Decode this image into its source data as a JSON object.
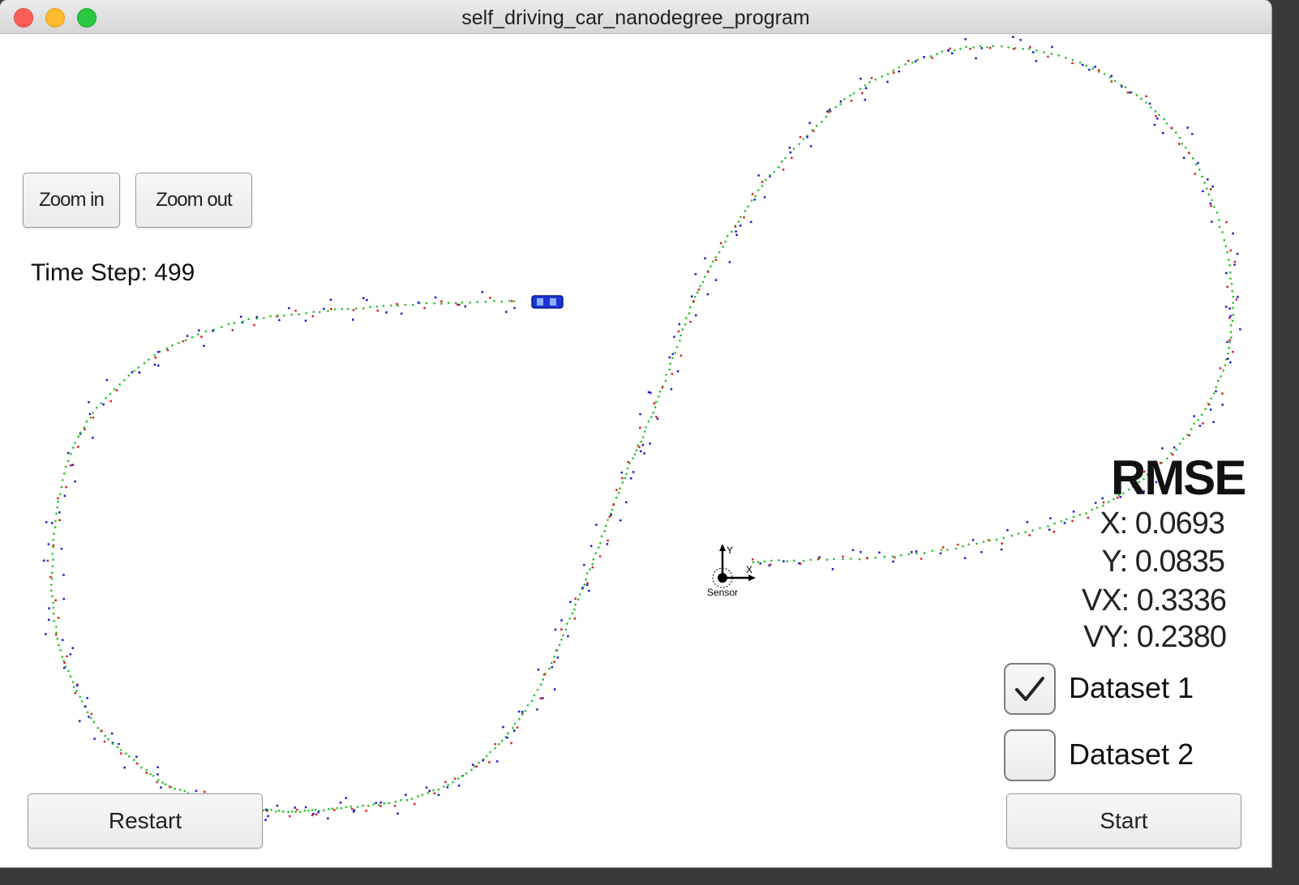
{
  "window": {
    "title": "self_driving_car_nanodegree_program"
  },
  "controls": {
    "zoom_in": "Zoom in",
    "zoom_out": "Zoom out",
    "restart": "Restart",
    "start": "Start"
  },
  "status": {
    "time_step_label": "Time Step: 499"
  },
  "rmse": {
    "title": "RMSE",
    "x": "X: 0.0693",
    "y": "Y: 0.0835",
    "vx": "VX: 0.3336",
    "vy": "VY: 0.2380"
  },
  "datasets": [
    {
      "label": "Dataset 1",
      "checked": true
    },
    {
      "label": "Dataset 2",
      "checked": false
    }
  ],
  "sensor": {
    "label": "Sensor",
    "x_axis": "X",
    "y_axis": "Y"
  },
  "colors": {
    "ground_truth": "#22c122",
    "lidar": "#e11b1b",
    "radar": "#1a1ad0",
    "car": "#1b34d8"
  }
}
